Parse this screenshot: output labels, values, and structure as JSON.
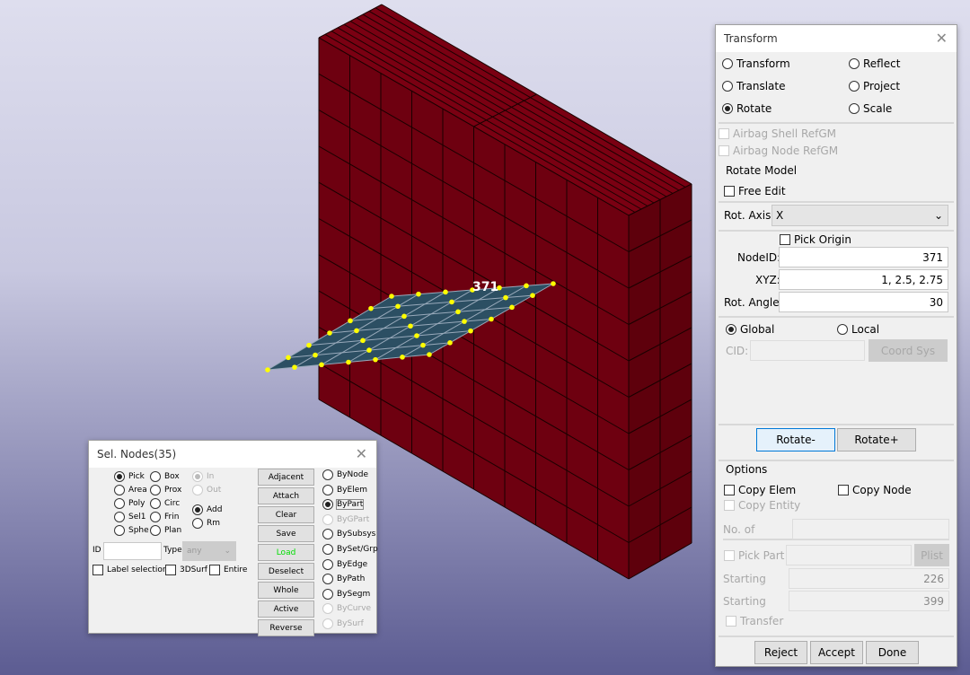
{
  "scene": {
    "node_label": "371",
    "wall_color": "#6e0010",
    "plate_color": "#2c4f63",
    "node_color": "#ffff00"
  },
  "transform": {
    "title": "Transform",
    "modes": [
      {
        "label": "Transform",
        "on": false
      },
      {
        "label": "Reflect",
        "on": false
      },
      {
        "label": "Translate",
        "on": false
      },
      {
        "label": "Project",
        "on": false
      },
      {
        "label": "Rotate",
        "on": true
      },
      {
        "label": "Scale",
        "on": false
      }
    ],
    "airbag_shell": "Airbag Shell RefGM",
    "airbag_node": "Airbag Node RefGM",
    "section": "Rotate Model",
    "free_edit": "Free Edit",
    "rot_axis_label": "Rot. Axis:",
    "rot_axis_value": "X",
    "pick_origin": "Pick Origin",
    "nodeid_label": "NodeID:",
    "nodeid": "371",
    "xyz_label": "XYZ:",
    "xyz": "1, 2.5, 2.75",
    "angle_label": "Rot. Angle:",
    "angle": "30",
    "global": "Global",
    "local": "Local",
    "cid_label": "CID:",
    "coord_sys": "Coord Sys",
    "rotate_minus": "Rotate-",
    "rotate_plus": "Rotate+",
    "options": "Options",
    "copy_elem": "Copy Elem",
    "copy_node": "Copy Node",
    "copy_entity": "Copy Entity",
    "no_of": "No. of",
    "pick_part": "Pick Part",
    "plist": "Plist",
    "starting1_label": "Starting",
    "starting1": "226",
    "starting2_label": "Starting",
    "starting2": "399",
    "transfer": "Transfer",
    "reject": "Reject",
    "accept": "Accept",
    "done": "Done"
  },
  "sel": {
    "title": "Sel. Nodes(35)",
    "col1": [
      "Pick",
      "Area",
      "Poly",
      "Sel1",
      "Sphe"
    ],
    "col2": [
      "Box",
      "Prox",
      "Circ",
      "Frin",
      "Plan"
    ],
    "in": "In",
    "out": "Out",
    "add": "Add",
    "rm": "Rm",
    "id_label": "ID",
    "type_label": "Type",
    "type_value": "any",
    "label_selection": "Label selection",
    "surf3d": "3DSurf",
    "entire": "Entire",
    "buttons": [
      "Adjacent",
      "Attach",
      "Clear",
      "Save",
      "Load",
      "Deselect",
      "Whole",
      "Active",
      "Reverse"
    ],
    "load_color": "#00dd00",
    "by": [
      {
        "label": "ByNode",
        "on": false,
        "dis": false
      },
      {
        "label": "ByElem",
        "on": false,
        "dis": false
      },
      {
        "label": "ByPart",
        "on": true,
        "dis": false
      },
      {
        "label": "ByGPart",
        "on": false,
        "dis": true
      },
      {
        "label": "BySubsys",
        "on": false,
        "dis": false
      },
      {
        "label": "BySet/Grp",
        "on": false,
        "dis": false
      },
      {
        "label": "ByEdge",
        "on": false,
        "dis": false
      },
      {
        "label": "ByPath",
        "on": false,
        "dis": false
      },
      {
        "label": "BySegm",
        "on": false,
        "dis": false
      },
      {
        "label": "ByCurve",
        "on": false,
        "dis": true
      },
      {
        "label": "BySurf",
        "on": false,
        "dis": true
      }
    ]
  }
}
